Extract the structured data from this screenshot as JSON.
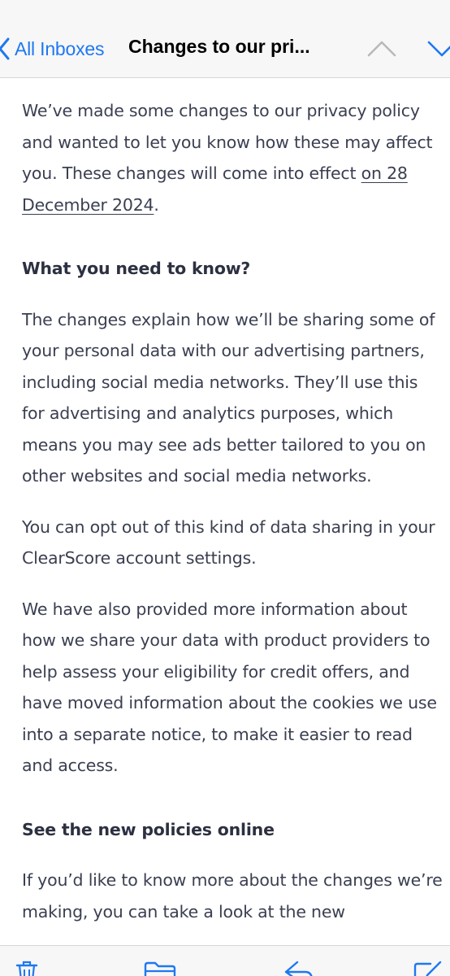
{
  "header": {
    "back_label": "All Inboxes",
    "title": "Changes to our pri...",
    "back_icon": "chevron-left-icon",
    "prev_icon": "chevron-up-icon",
    "next_icon": "chevron-down-icon"
  },
  "email": {
    "intro_before": "We’ve made some changes to our privacy policy and wanted to let you know how these may affect you. These changes will come into effect ",
    "intro_link": "on 28 December 2024",
    "intro_after": ".",
    "heading1": "What you need to know?",
    "para1": "The changes explain how we’ll be sharing some of your personal data with our advertising partners, including social media networks. They’ll use this for advertising and analytics purposes, which means you may see ads better tailored to you on other websites and social media networks.",
    "para2": "You can opt out of this kind of data sharing in your ClearScore account settings.",
    "para3": "We have also provided more information about how we share your data with product providers to help assess your eligibility for credit offers, and have moved information about the cookies we use into a separate notice, to make it easier to read and access.",
    "heading2": "See the new policies online",
    "para4": "If you’d like to know more about the changes we’re making, you can take a look at the new"
  },
  "toolbar": {
    "icons": [
      "trash-icon",
      "folder-icon",
      "reply-icon",
      "compose-icon"
    ]
  },
  "colors": {
    "accent": "#1e78f0",
    "body_text": "#3a3f51",
    "bar_bg": "#f7f7f8"
  }
}
